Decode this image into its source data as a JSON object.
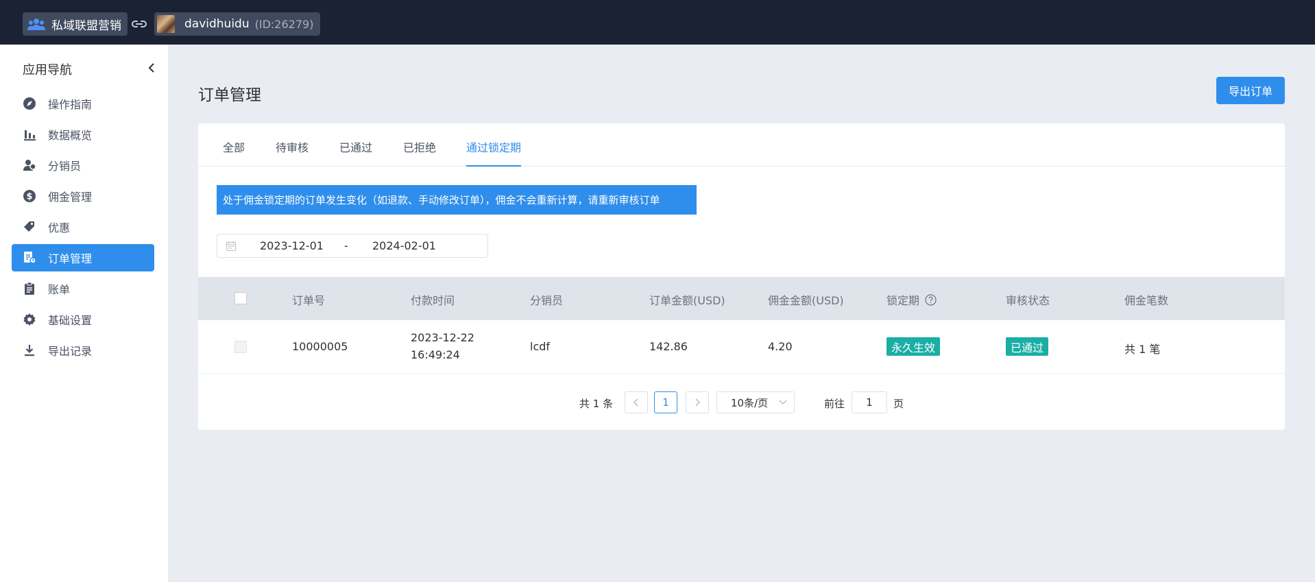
{
  "topbar": {
    "app_name": "私域联盟营销",
    "user_name": "davidhuidu",
    "user_id": "(ID:26279)"
  },
  "sidebar": {
    "title": "应用导航",
    "items": [
      {
        "label": "操作指南",
        "icon": "navigation-icon"
      },
      {
        "label": "数据概览",
        "icon": "bar-chart-icon"
      },
      {
        "label": "分销员",
        "icon": "user-group-icon"
      },
      {
        "label": "佣金管理",
        "icon": "dollar-icon"
      },
      {
        "label": "优惠",
        "icon": "tag-icon"
      },
      {
        "label": "订单管理",
        "icon": "order-icon",
        "active": true
      },
      {
        "label": "账单",
        "icon": "clipboard-icon"
      },
      {
        "label": "基础设置",
        "icon": "gear-icon"
      },
      {
        "label": "导出记录",
        "icon": "download-icon"
      }
    ]
  },
  "main": {
    "title": "订单管理",
    "export_label": "导出订单",
    "tabs": [
      "全部",
      "待审核",
      "已通过",
      "已拒绝",
      "通过锁定期"
    ],
    "active_tab": "通过锁定期",
    "notice": "处于佣金锁定期的订单发生变化（如退款、手动修改订单），佣金不会重新计算，请重新审核订单",
    "date_range": {
      "start": "2023-12-01",
      "separator": "-",
      "end": "2024-02-01"
    },
    "table": {
      "columns": [
        "订单号",
        "付款时间",
        "分销员",
        "订单金额(USD)",
        "佣金金额(USD)",
        "锁定期",
        "审核状态",
        "佣金笔数"
      ],
      "rows": [
        {
          "order_no": "10000005",
          "pay_date": "2023-12-22",
          "pay_time": "16:49:24",
          "distributor": "lcdf",
          "order_amount": "142.86",
          "commission": "4.20",
          "lock_period": "永久生效",
          "review_status": "已通过",
          "commission_count": "共 1 笔"
        }
      ]
    },
    "pagination": {
      "total": "共 1 条",
      "current_page": "1",
      "page_size": "10条/页",
      "goto_label": "前往",
      "goto_value": "1",
      "page_suffix": "页"
    }
  },
  "colors": {
    "topbar_bg": "#1b2233",
    "primary": "#2f8eeb",
    "tag_teal": "#1aaea5",
    "page_bg": "#e9edf3"
  }
}
